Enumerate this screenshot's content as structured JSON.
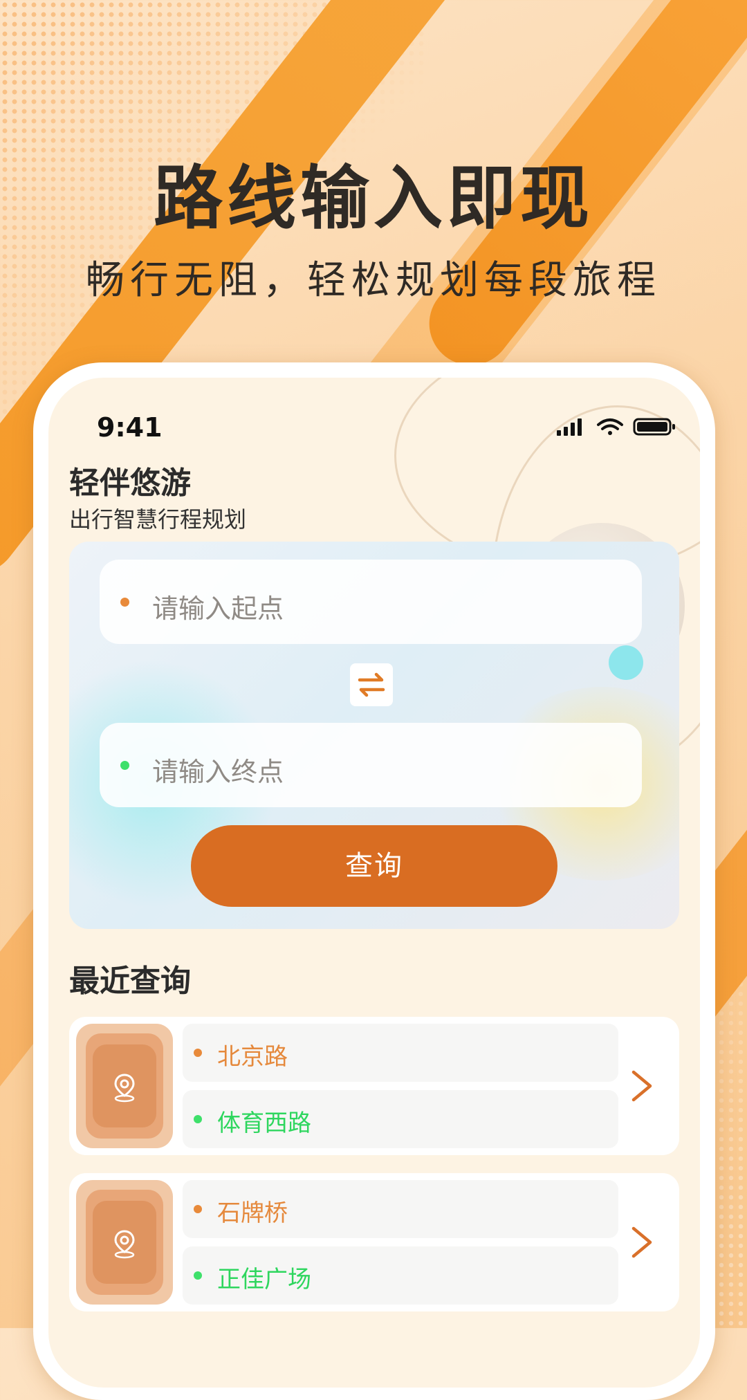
{
  "hero": {
    "title": "路线输入即现",
    "subtitle": "畅行无阻，轻松规划每段旅程"
  },
  "status_bar": {
    "time": "9:41"
  },
  "app": {
    "name": "轻伴悠游",
    "tagline": "出行智慧行程规划"
  },
  "search": {
    "start_placeholder": "请输入起点",
    "end_placeholder": "请输入终点",
    "query_label": "查询"
  },
  "recent": {
    "title": "最近查询",
    "items": [
      {
        "from": "北京路",
        "to": "体育西路"
      },
      {
        "from": "石牌桥",
        "to": "正佳广场"
      }
    ]
  },
  "colors": {
    "accent": "#d96d22",
    "start_dot": "#e88a3a",
    "end_dot": "#3ee06a",
    "from_text": "#e5893c",
    "to_text": "#2ed65e"
  },
  "icons": {
    "swap": "swap-icon",
    "location": "location-pin-icon",
    "chevron": "chevron-right-icon"
  }
}
